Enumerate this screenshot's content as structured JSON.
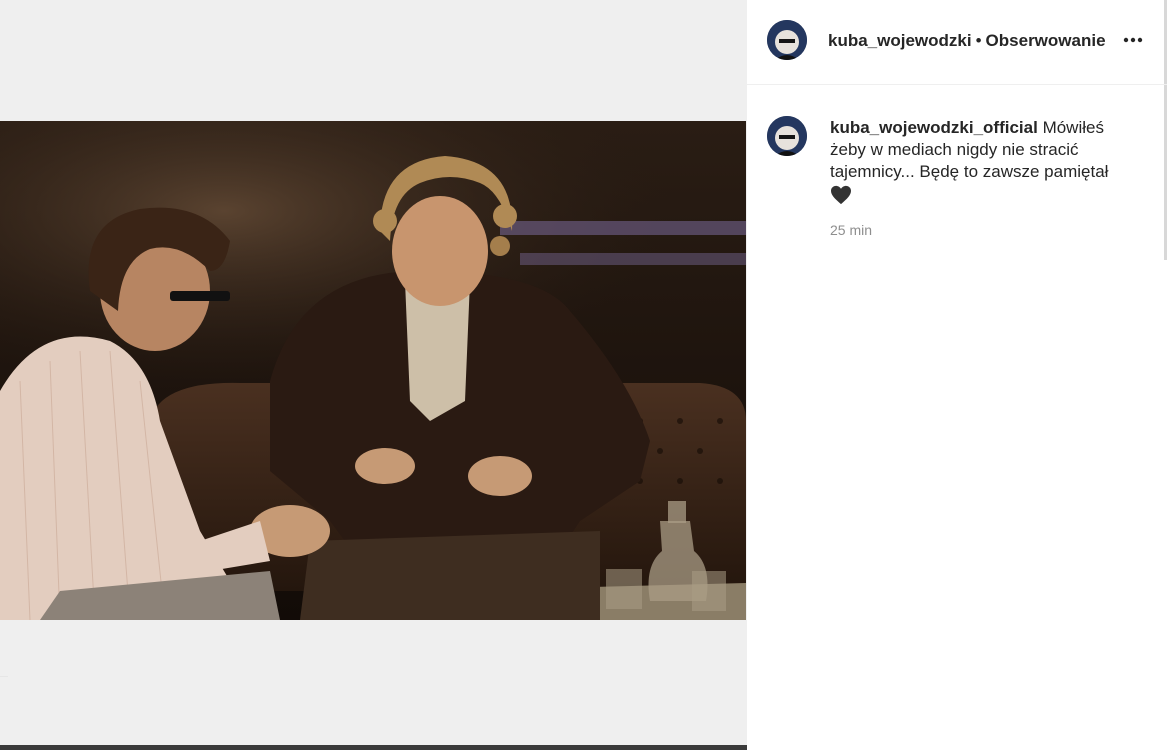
{
  "post": {
    "image_alt": "Two men talking on a leather sofa in a TV studio, sepia tone"
  },
  "header": {
    "username": "kuba_wojewodzki",
    "separator": "•",
    "follow_label": "Obserwowanie",
    "more_icon": "more-options-icon"
  },
  "caption": {
    "username": "kuba_wojewodzki_official",
    "text": "Mówiłeś żeby w mediach nigdy nie stracić tajemnicy... Będę to zawsze pamiętał",
    "emoji_icon": "black-heart-icon",
    "time": "25 min"
  },
  "colors": {
    "background_media": "#efefef",
    "text_primary": "#262626",
    "text_secondary": "#8e8e8e",
    "border": "#efefef"
  }
}
